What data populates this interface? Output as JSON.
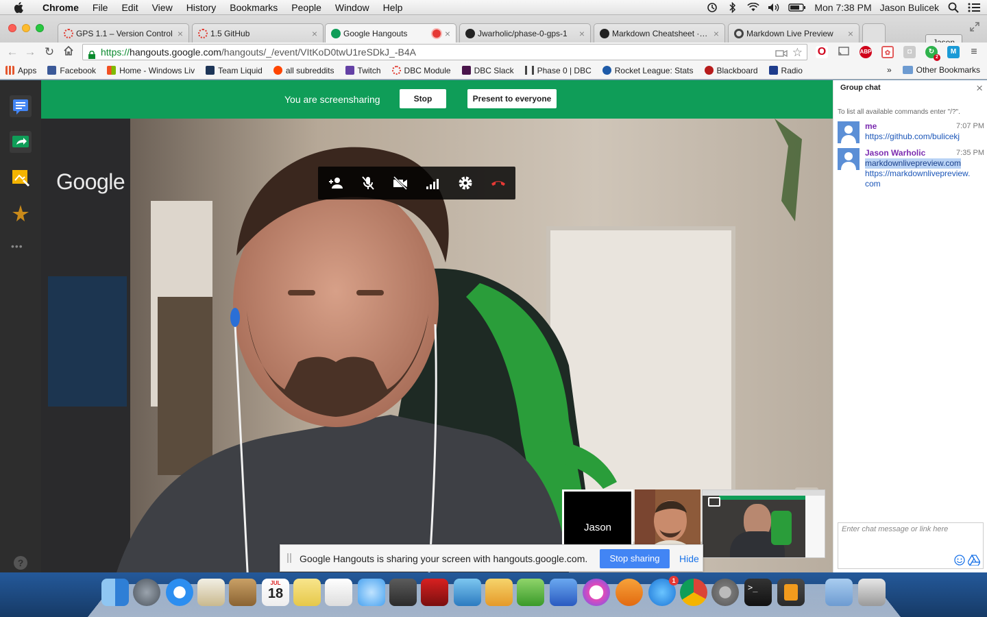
{
  "menubar": {
    "app": "Chrome",
    "items": [
      "File",
      "Edit",
      "View",
      "History",
      "Bookmarks",
      "People",
      "Window",
      "Help"
    ],
    "clock": "Mon 7:38 PM",
    "user": "Jason Bulicek"
  },
  "tabs": [
    {
      "title": "GPS 1.1 – Version Control",
      "favicon_color": "#e0362c"
    },
    {
      "title": "1.5 GitHub",
      "favicon_color": "#e0362c"
    },
    {
      "title": "Google Hangouts",
      "favicon_color": "#0f9d58",
      "active": true,
      "recording": true
    },
    {
      "title": "Jwarholic/phase-0-gps-1",
      "favicon_color": "#222222"
    },
    {
      "title": "Markdown Cheatsheet · ad",
      "favicon_color": "#222222"
    },
    {
      "title": "Markdown Live Preview",
      "favicon_color": "#444444"
    }
  ],
  "profile_button": "Jason",
  "address": {
    "scheme": "https://",
    "host": "hangouts.google.com",
    "path": "/hangouts/_/event/VItKoD0twU1reSDkJ_-B4A"
  },
  "bookmarks": [
    {
      "label": "Apps",
      "color": "#e4572e"
    },
    {
      "label": "Facebook",
      "color": "#3b5998"
    },
    {
      "label": "Home - Windows Liv",
      "color": "#f25022"
    },
    {
      "label": "Team Liquid",
      "color": "#1d3557"
    },
    {
      "label": "all subreddits",
      "color": "#ff4500"
    },
    {
      "label": "Twitch",
      "color": "#6441a5"
    },
    {
      "label": "DBC Module",
      "color": "#e0362c"
    },
    {
      "label": "DBC Slack",
      "color": "#4a154b"
    },
    {
      "label": "Phase 0 | DBC",
      "color": "#444444"
    },
    {
      "label": "Rocket League: Stats",
      "color": "#1e5ba8"
    },
    {
      "label": "Blackboard",
      "color": "#b71c1c"
    },
    {
      "label": "Radio",
      "color": "#1e3c8c"
    }
  ],
  "bookmarks_overflow": "»",
  "other_bookmarks": "Other Bookmarks",
  "hangout": {
    "banner_text": "You are screensharing",
    "stop_label": "Stop",
    "present_label": "Present to everyone",
    "logo": "Google",
    "hd_label": "HD",
    "thumb_name": "Jason",
    "share_message": "Google Hangouts is sharing your screen with hangouts.google.com.",
    "stop_sharing_label": "Stop sharing",
    "hide_label": "Hide",
    "help_label": "?",
    "sidebar_more": "•••"
  },
  "chat": {
    "title": "Group chat",
    "hint": "To list all available commands enter \"/?\".",
    "messages": [
      {
        "sender": "me",
        "time": "7:07 PM",
        "lines": [
          "https://github.com/bulicekj"
        ]
      },
      {
        "sender": "Jason Warholic",
        "time": "7:35 PM",
        "lines": [
          "markdownlivepreview.com",
          "https://markdownlivepreview.",
          "com"
        ]
      }
    ],
    "placeholder": "Enter chat message or link here"
  },
  "dock_icons": [
    "finder-icon",
    "launchpad-icon",
    "safari-icon",
    "mail-icon",
    "contacts-icon",
    "calendar-icon",
    "notes-icon",
    "reminders-icon",
    "messages-icon",
    "facetime-icon",
    "photo-booth-icon",
    "iphoto-icon",
    "pages-icon",
    "numbers-icon",
    "keynote-icon",
    "itunes-icon",
    "ibooks-icon",
    "app-store-icon",
    "chrome-icon",
    "system-preferences-icon",
    "terminal-icon",
    "sublime-text-icon",
    "downloads-folder-icon",
    "trash-icon"
  ],
  "dock_calendar_day": "18",
  "dock_calendar_month": "JUL",
  "dock_appstore_badge": "1",
  "colors": {
    "banner_green": "#0f9d58",
    "accent_blue": "#4285f4",
    "chat_name_purple": "#7b2bb0",
    "hangup_red": "#e53935"
  }
}
